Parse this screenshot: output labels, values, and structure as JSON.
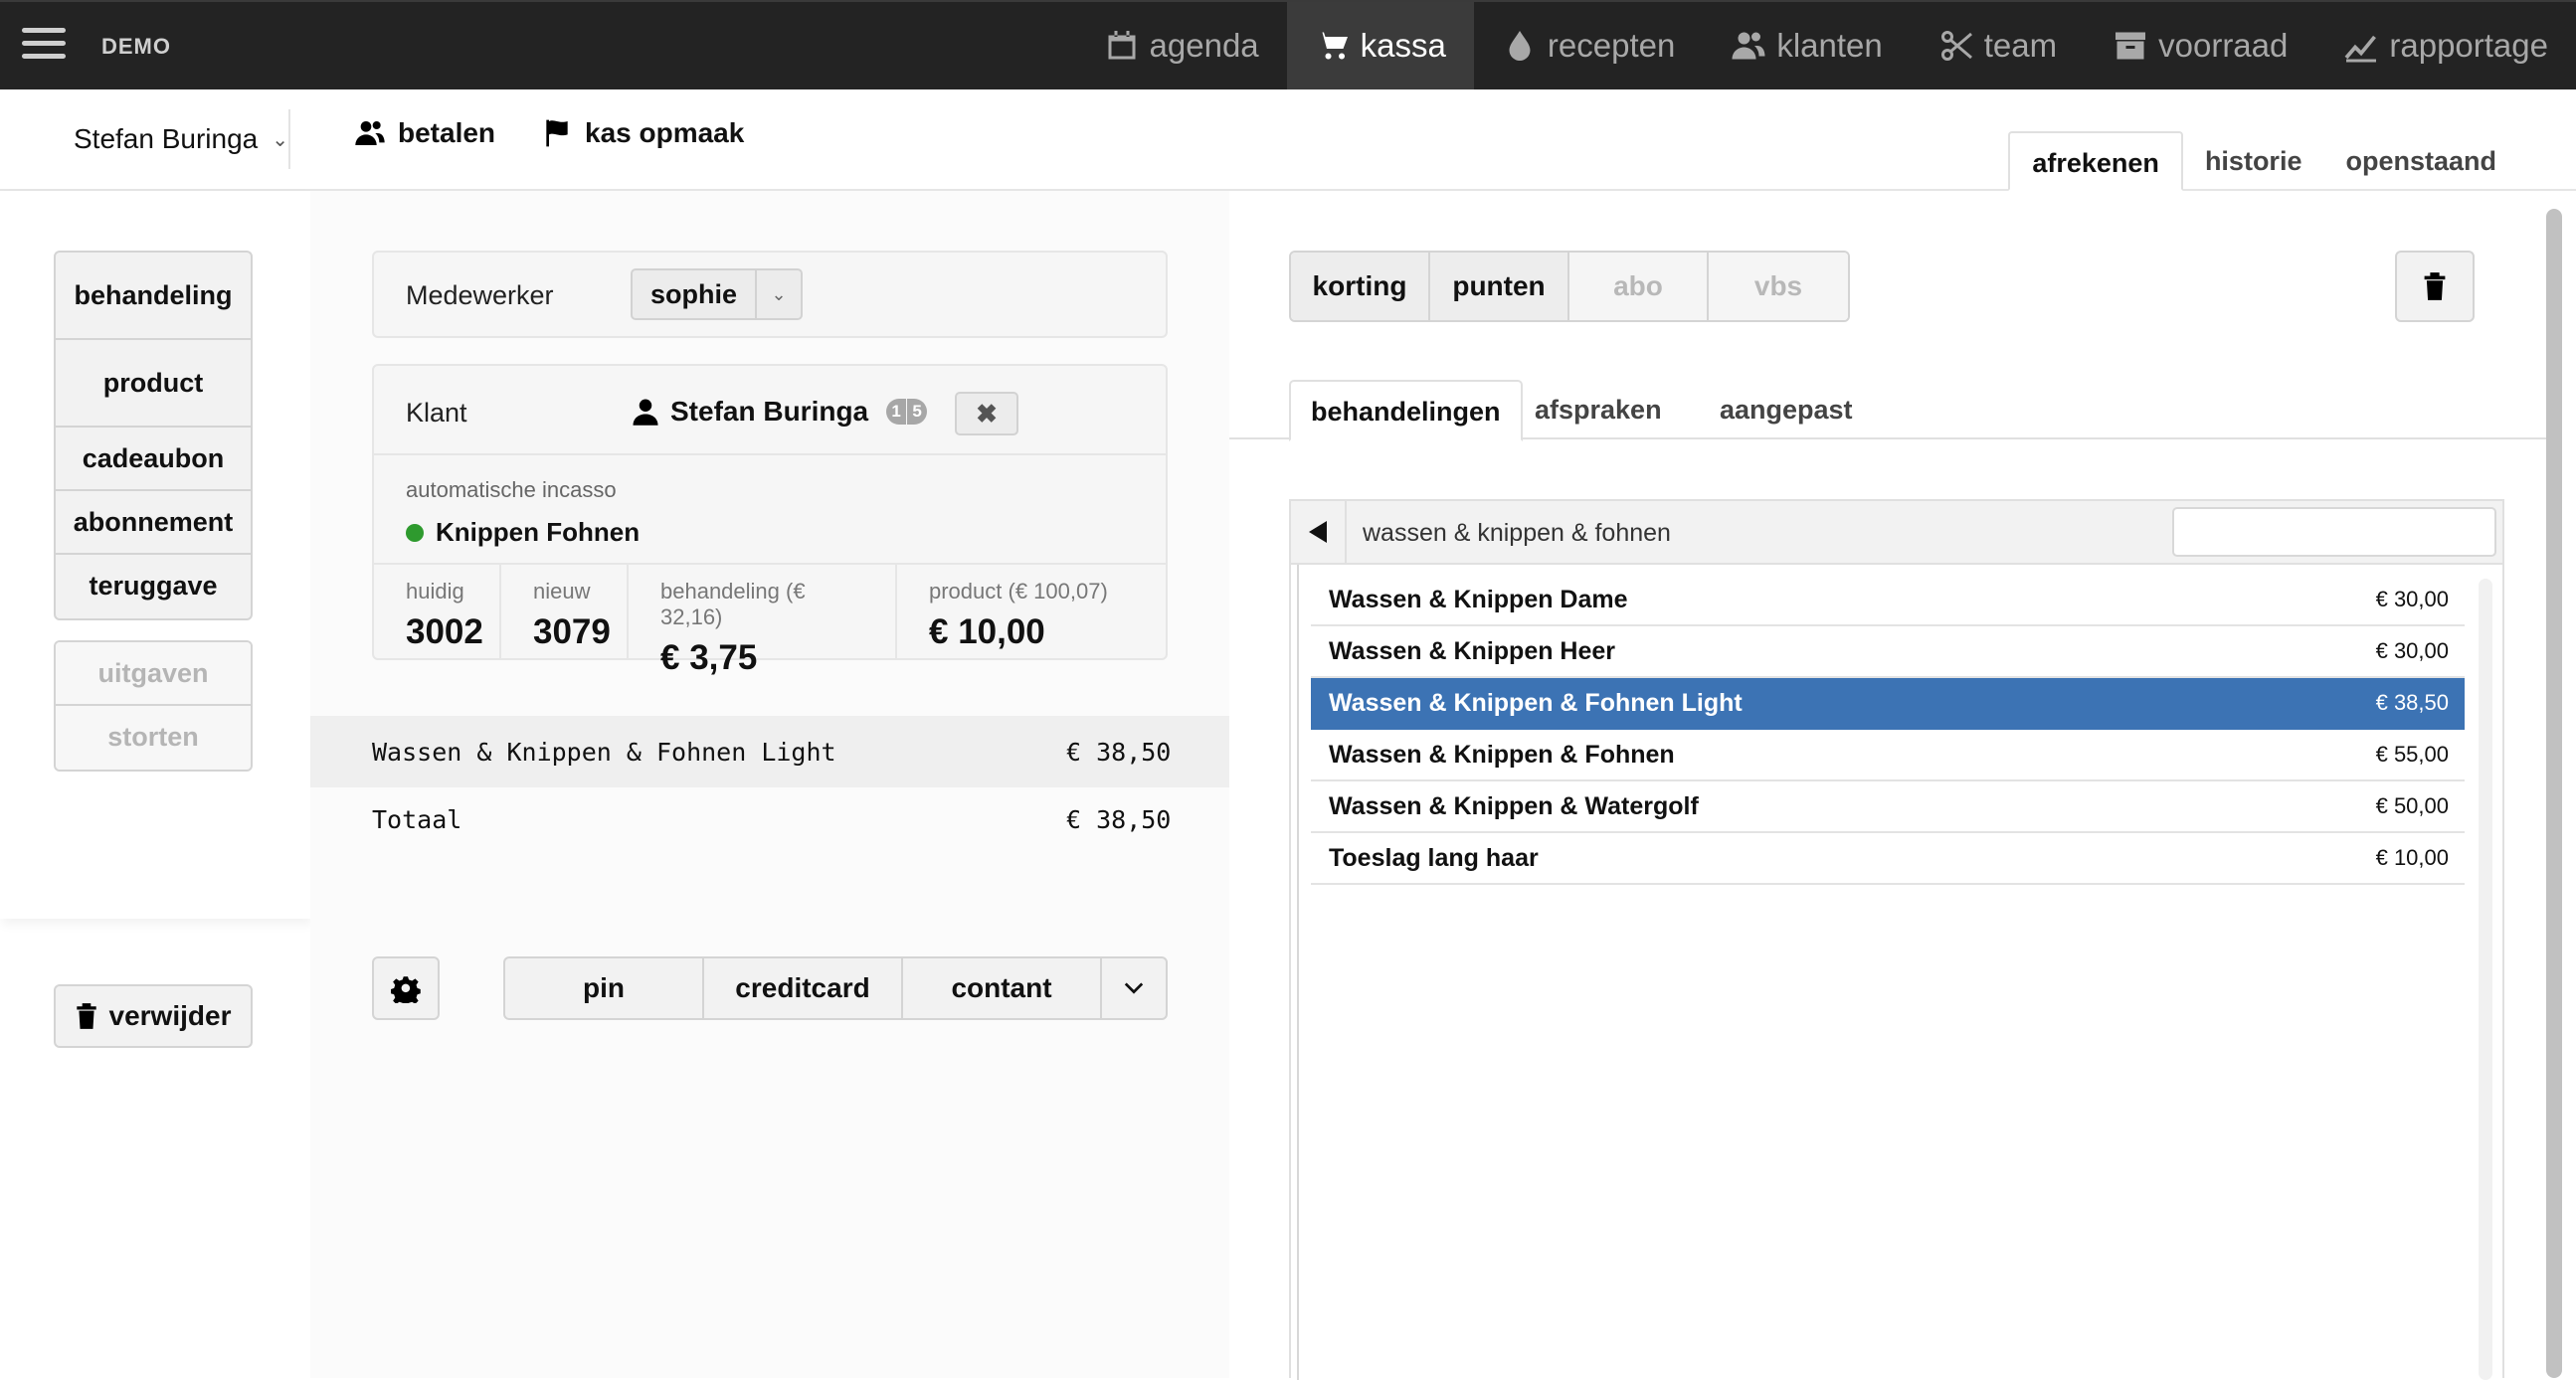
{
  "brand": "DEMO",
  "nav": [
    {
      "label": "agenda",
      "icon": "calendar-icon"
    },
    {
      "label": "kassa",
      "icon": "cart-icon",
      "active": true
    },
    {
      "label": "recepten",
      "icon": "drop-icon"
    },
    {
      "label": "klanten",
      "icon": "users-icon"
    },
    {
      "label": "team",
      "icon": "scissors-icon"
    },
    {
      "label": "voorraad",
      "icon": "archive-icon"
    },
    {
      "label": "rapportage",
      "icon": "chart-line-icon"
    }
  ],
  "subheader": {
    "user": "Stefan Buringa",
    "actions": {
      "pay": "betalen",
      "close": "kas opmaak"
    },
    "tabs": [
      "afrekenen",
      "historie",
      "openstaand"
    ]
  },
  "left": {
    "types": [
      "behandeling",
      "product",
      "cadeaubon",
      "abonnement",
      "teruggave"
    ],
    "cash": [
      "uitgaven",
      "storten"
    ],
    "delete": "verwijder"
  },
  "employee": {
    "label": "Medewerker",
    "value": "sophie"
  },
  "client": {
    "label": "Klant",
    "name": "Stefan Buringa",
    "badge": [
      "1",
      "5"
    ],
    "incasso": "automatische incasso",
    "subscription": "Knippen Fohnen",
    "stats": [
      {
        "label": "huidig",
        "value": "3002"
      },
      {
        "label": "nieuw",
        "value": "3079"
      },
      {
        "label": "behandeling (€ 32,16)",
        "value": "€ 3,75"
      },
      {
        "label": "product (€ 100,07)",
        "value": "€ 10,00"
      }
    ]
  },
  "receipt": {
    "item": {
      "name": "Wassen & Knippen & Fohnen Light",
      "price": "€ 38,50"
    },
    "total": {
      "label": "Totaal",
      "price": "€ 38,50"
    }
  },
  "payment": [
    "pin",
    "creditcard",
    "contant"
  ],
  "discounts": [
    {
      "label": "korting",
      "enabled": true
    },
    {
      "label": "punten",
      "enabled": true
    },
    {
      "label": "abo",
      "enabled": false
    },
    {
      "label": "vbs",
      "enabled": false
    }
  ],
  "catalog_tabs": [
    "behandelingen",
    "afspraken",
    "aangepast"
  ],
  "breadcrumb": "wassen & knippen & fohnen",
  "search_placeholder": "",
  "products": [
    {
      "name": "Wassen & Knippen Dame",
      "price": "€ 30,00"
    },
    {
      "name": "Wassen & Knippen Heer",
      "price": "€ 30,00"
    },
    {
      "name": "Wassen & Knippen & Fohnen Light",
      "price": "€ 38,50",
      "selected": true
    },
    {
      "name": "Wassen & Knippen & Fohnen",
      "price": "€ 55,00"
    },
    {
      "name": "Wassen & Knippen & Watergolf",
      "price": "€ 50,00"
    },
    {
      "name": "Toeslag lang haar",
      "price": "€ 10,00"
    }
  ],
  "colors": {
    "topbar": "#232323",
    "selected_row": "#3c73b4",
    "status_dot": "#2e9a2e"
  }
}
